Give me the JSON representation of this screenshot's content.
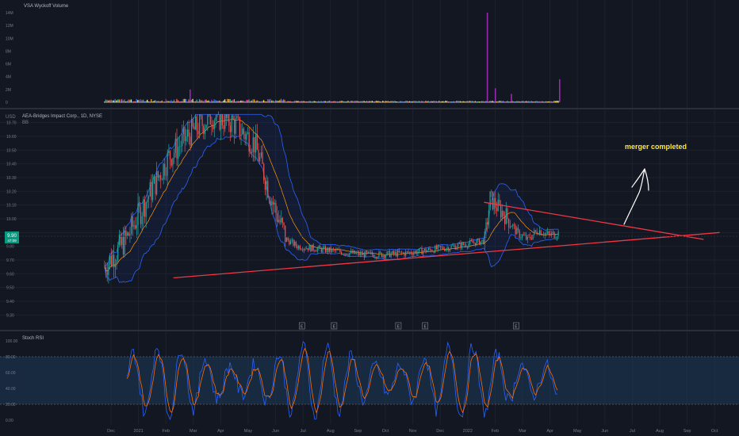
{
  "colors": {
    "background": "#131722",
    "grid": "#1e222d",
    "axis_text": "#787b86",
    "bull": "#26a69a",
    "bear": "#ef5350",
    "bollinger": "#2962ff",
    "bollinger_fill": "#1e3a8a",
    "basis": "#ff9800",
    "trendline": "#f23645",
    "annotation": "#ffeb3b",
    "stoch_k": "#2962ff",
    "stoch_d": "#ff6d00",
    "stoch_band": "#1c3a57",
    "price_tag": "#089981",
    "volume_spike": "#9c27b0"
  },
  "volume_panel": {
    "title": "VSA Wyckoff Volume",
    "y_ticks": [
      "14M",
      "12M",
      "10M",
      "8M",
      "6M",
      "4M",
      "2M",
      "0"
    ]
  },
  "price_panel": {
    "legend": "AEA-Bridges Impact Corp., 1D, NYSE",
    "indicator": "BB",
    "unit": "USD",
    "y_ticks": [
      "10.70",
      "10.60",
      "10.50",
      "10.40",
      "10.30",
      "10.20",
      "10.10",
      "10.00",
      "9.90",
      "9.80",
      "9.70",
      "9.60",
      "9.50",
      "9.40",
      "9.30"
    ],
    "current_price": "9.90",
    "current_tag_sub": "47:09",
    "annotation": "merger completed",
    "earnings_marker": "E"
  },
  "stoch_panel": {
    "title": "Stoch RSI",
    "y_ticks": [
      "100.00",
      "80.00",
      "60.00",
      "40.00",
      "20.00",
      "0.00"
    ]
  },
  "x_axis": {
    "labels": [
      "Dec",
      "2021",
      "Feb",
      "Mar",
      "Apr",
      "May",
      "Jun",
      "Jul",
      "Aug",
      "Sep",
      "Oct",
      "Nov",
      "Dec",
      "2022",
      "Feb",
      "Mar",
      "Apr",
      "May",
      "Jun",
      "Jul",
      "Aug",
      "Sep",
      "Oct"
    ]
  },
  "chart_data": {
    "type": "candlestick",
    "title": "AEA-Bridges Impact Corp., 1D, NYSE",
    "ylabel": "USD",
    "ylim": [
      9.25,
      10.75
    ],
    "price_path": [
      [
        0,
        9.65
      ],
      [
        4,
        9.85
      ],
      [
        8,
        10.15
      ],
      [
        12,
        10.45
      ],
      [
        16,
        10.62
      ],
      [
        20,
        10.75
      ],
      [
        24,
        10.7
      ],
      [
        28,
        10.55
      ],
      [
        30,
        10.3
      ],
      [
        32,
        10.05
      ],
      [
        34,
        9.85
      ],
      [
        36,
        9.8
      ],
      [
        40,
        9.78
      ],
      [
        44,
        9.76
      ],
      [
        48,
        9.74
      ],
      [
        52,
        9.74
      ],
      [
        56,
        9.75
      ],
      [
        60,
        9.77
      ],
      [
        64,
        9.79
      ],
      [
        68,
        9.82
      ],
      [
        71,
        9.84
      ],
      [
        72,
        10.15
      ],
      [
        73,
        10.1
      ],
      [
        75,
        10.02
      ],
      [
        77,
        9.9
      ],
      [
        79,
        9.85
      ],
      [
        81,
        9.92
      ],
      [
        83,
        9.88
      ],
      [
        85,
        9.9
      ]
    ],
    "upper_trendline": {
      "from": [
        71,
        10.12
      ],
      "to": [
        112,
        9.85
      ]
    },
    "lower_trendline": {
      "from": [
        13,
        9.57
      ],
      "to": [
        115,
        9.9
      ]
    },
    "volume_spikes": [
      {
        "x": 16,
        "value": 2.0
      },
      {
        "x": 71.5,
        "value": 14.0
      },
      {
        "x": 73,
        "value": 2.2
      },
      {
        "x": 76,
        "value": 1.3
      },
      {
        "x": 85,
        "value": 3.6
      }
    ],
    "earnings_x": [
      37,
      43,
      55,
      60,
      77
    ]
  }
}
